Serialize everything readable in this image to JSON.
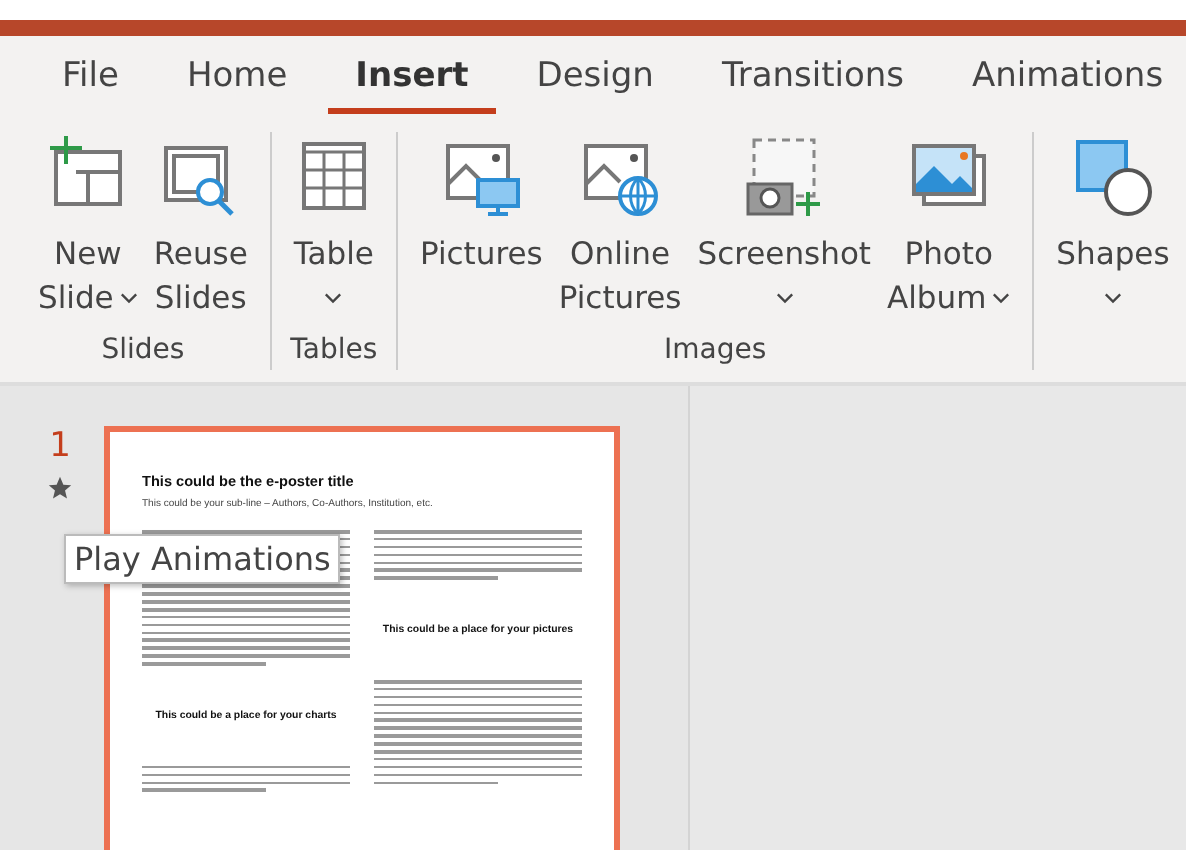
{
  "tabs": [
    {
      "label": "File",
      "selected": false
    },
    {
      "label": "Home",
      "selected": false
    },
    {
      "label": "Insert",
      "selected": true
    },
    {
      "label": "Design",
      "selected": false
    },
    {
      "label": "Transitions",
      "selected": false
    },
    {
      "label": "Animations",
      "selected": false
    }
  ],
  "ribbon": [
    {
      "label": "Slides",
      "buttons": [
        {
          "kind": "newslide",
          "lines": [
            "New",
            "Slide"
          ],
          "dropdown": true
        },
        {
          "kind": "reuse",
          "lines": [
            "Reuse",
            "Slides"
          ],
          "dropdown": false
        }
      ]
    },
    {
      "label": "Tables",
      "buttons": [
        {
          "kind": "table",
          "lines": [
            "Table"
          ],
          "dropdown": true
        }
      ]
    },
    {
      "label": "Images",
      "buttons": [
        {
          "kind": "pictures",
          "lines": [
            "Pictures"
          ],
          "dropdown": false
        },
        {
          "kind": "online",
          "lines": [
            "Online",
            "Pictures"
          ],
          "dropdown": false
        },
        {
          "kind": "screenshot",
          "lines": [
            "Screenshot"
          ],
          "dropdown": true
        },
        {
          "kind": "album",
          "lines": [
            "Photo",
            "Album"
          ],
          "dropdown": true
        }
      ]
    },
    {
      "buttons": [
        {
          "kind": "shapes",
          "lines": [
            "Shapes"
          ],
          "dropdown": true
        }
      ]
    }
  ],
  "slides": [
    {
      "number": "1",
      "animated": true,
      "selected": true,
      "title": "This could be the e-poster title",
      "subtitle": "This could be your sub-line – Authors, Co-Authors, Institution, etc.",
      "left_heading": "This could be a place for your charts",
      "right_heading": "This could be a place for your pictures"
    }
  ],
  "tooltip": "Play Animations"
}
